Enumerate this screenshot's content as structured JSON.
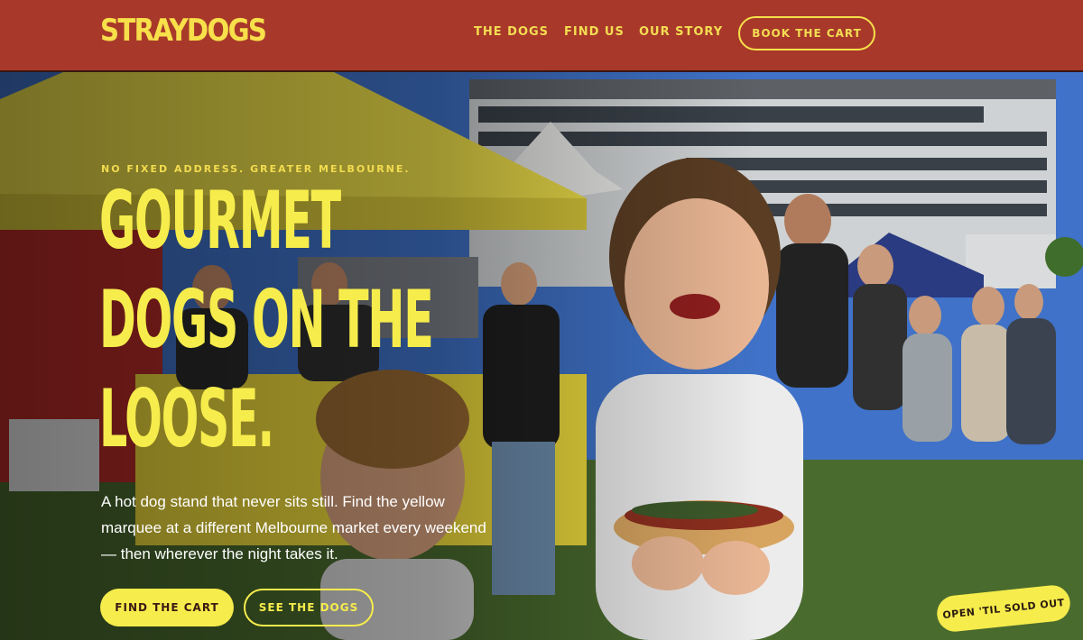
{
  "brand": {
    "logo_text": "STRAYDOGS"
  },
  "nav": {
    "links": [
      "THE DOGS",
      "FIND US",
      "OUR STORY"
    ],
    "cta": "BOOK THE CART"
  },
  "hero": {
    "eyebrow": "NO FIXED ADDRESS. GREATER MELBOURNE.",
    "headline_lines": [
      "GOURMET",
      "DOGS ON THE",
      "LOOSE."
    ],
    "intro": "A hot dog stand that never sits still. Find the yellow marquee at a different Melbourne market every weekend — then wherever the night takes it.",
    "primary_button": "FIND THE CART",
    "secondary_button": "SEE THE DOGS",
    "badge": "OPEN 'TIL SOLD OUT"
  },
  "colors": {
    "header_bg": "#a8392a",
    "accent_yellow": "#f6ec4c",
    "marquee_yellow": "#efe04a"
  }
}
